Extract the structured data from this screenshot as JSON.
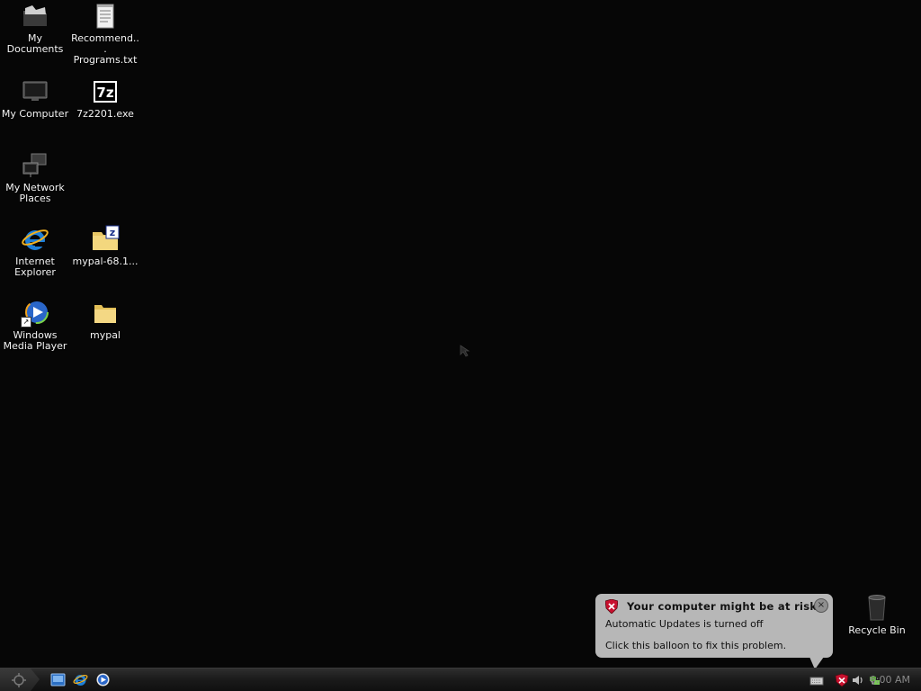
{
  "desktop": {
    "icons": [
      {
        "label": "My Documents",
        "icon": "my-documents-icon"
      },
      {
        "label": "Recommend...\nPrograms.txt",
        "icon": "text-file-icon"
      },
      {
        "label": "My Computer",
        "icon": "my-computer-icon"
      },
      {
        "label": "7z2201.exe",
        "icon": "7zip-icon"
      },
      {
        "label": "My Network Places",
        "icon": "network-places-icon"
      },
      {
        "label": "Internet Explorer",
        "icon": "internet-explorer-icon"
      },
      {
        "label": "mypal-68.1...",
        "icon": "zip-folder-icon"
      },
      {
        "label": "Windows Media Player",
        "icon": "windows-media-player-icon"
      },
      {
        "label": "mypal",
        "icon": "folder-icon"
      },
      {
        "label": "Recycle Bin",
        "icon": "recycle-bin-icon"
      }
    ]
  },
  "balloon": {
    "title": "Your computer might be at risk",
    "line1": "Automatic Updates is turned off",
    "line2": "Click this balloon to fix this problem.",
    "close": "×"
  },
  "taskbar": {
    "clock": "6:00 AM",
    "quicklaunch": [
      "show-desktop-icon",
      "internet-explorer-icon",
      "windows-media-player-icon"
    ],
    "tray": [
      "keyboard-icon",
      "security-shield-icon",
      "volume-icon",
      "network-icon"
    ]
  },
  "colors": {
    "desktop_bg": "#060606",
    "balloon_bg": "#b7b7b7",
    "shield_red": "#c8102e"
  }
}
